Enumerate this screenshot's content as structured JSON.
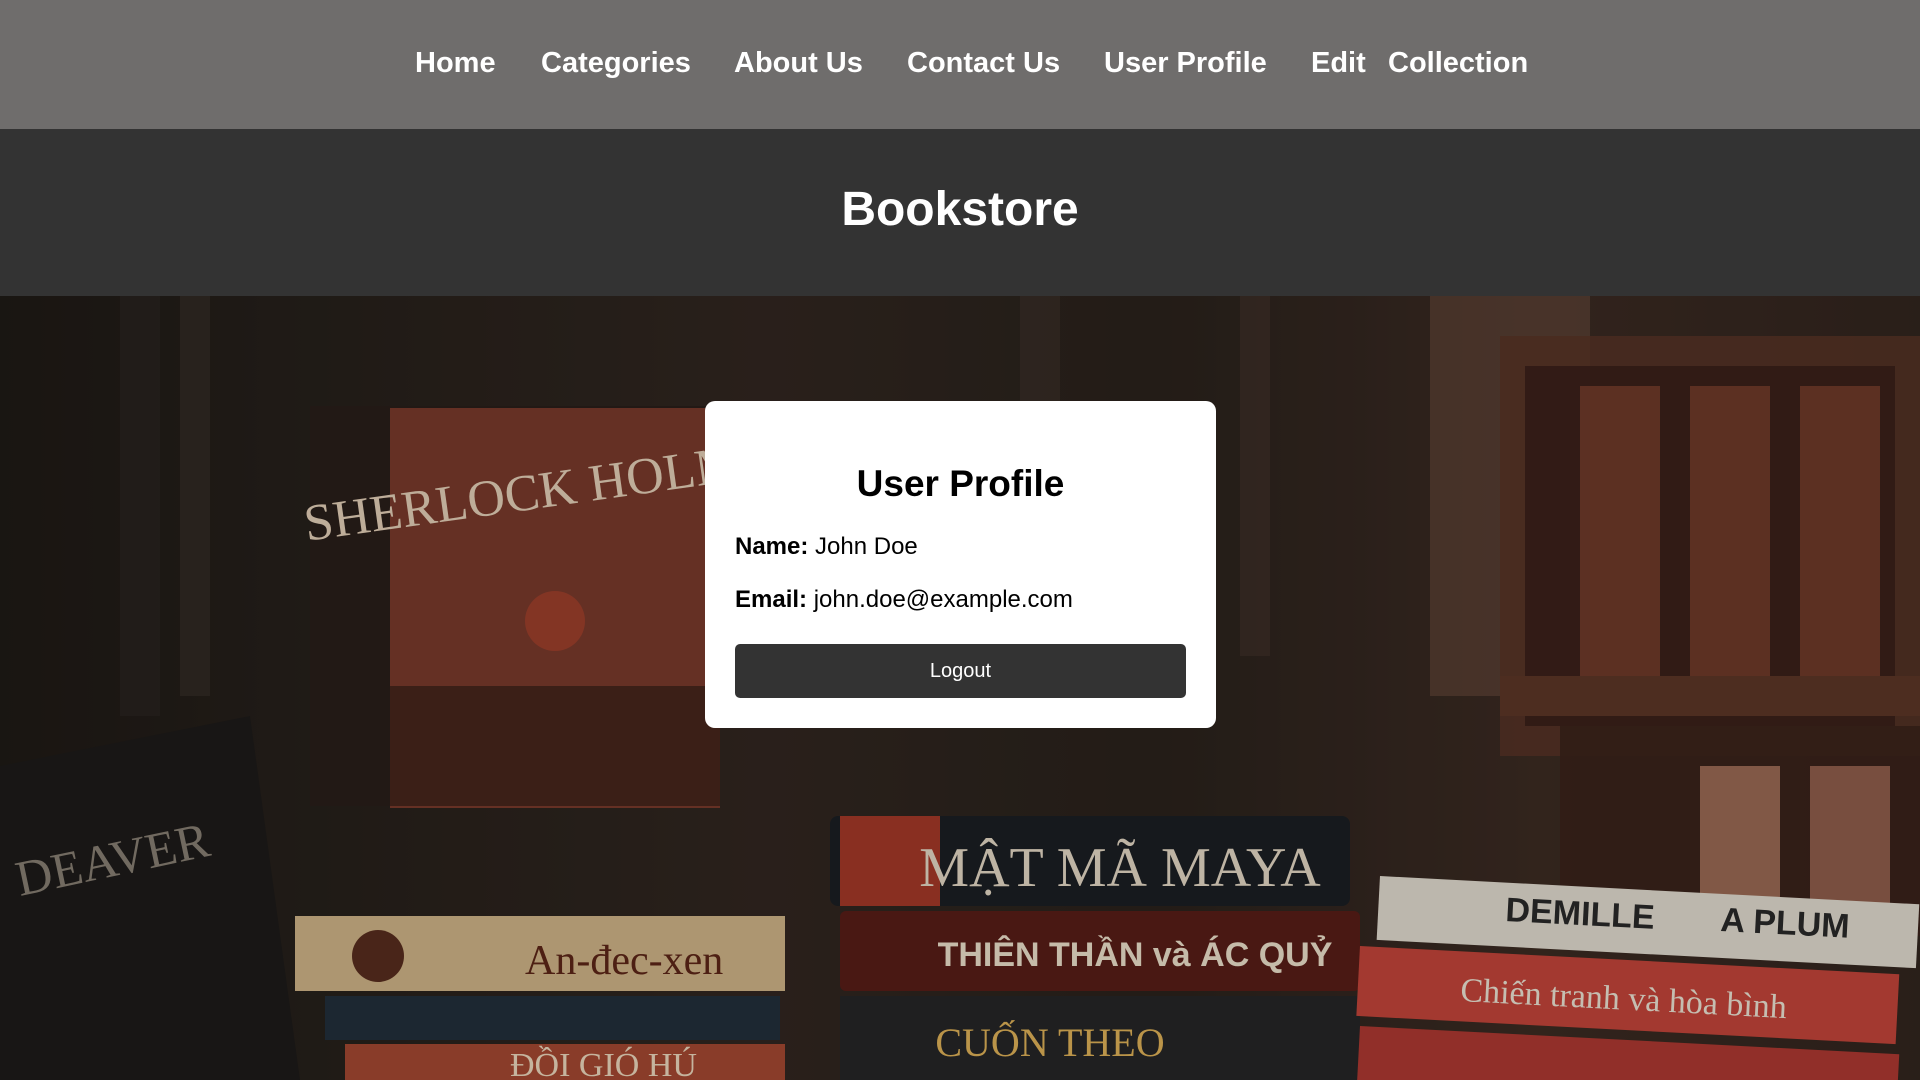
{
  "nav": {
    "items": [
      {
        "label": "Home"
      },
      {
        "label": "Categories"
      },
      {
        "label": "About Us"
      },
      {
        "label": "Contact Us"
      },
      {
        "label": "User Profile"
      },
      {
        "label": "Edit"
      },
      {
        "label": "Collection"
      }
    ]
  },
  "header": {
    "title": "Bookstore"
  },
  "profile": {
    "title": "User Profile",
    "name_label": "Name:",
    "name_value": "John Doe",
    "email_label": "Email:",
    "email_value": "john.doe@example.com",
    "logout_label": "Logout"
  },
  "background": {
    "book_titles": [
      "SHERLOCK HOLMES",
      "MẬT MÃ MAYA",
      "THIÊN THẦN và ÁC QUỶ",
      "An-đec-xen",
      "ĐỒI GIÓ HÚ",
      "CUỐN THEO CHIỀU GIÓ",
      "DEMILLE",
      "A PLUM",
      "Chiến tranh và hòa bình",
      "DEAVER"
    ]
  },
  "colors": {
    "nav_bg": "#6f6d6c",
    "header_bg": "#333333",
    "card_bg": "#ffffff",
    "button_bg": "#333333"
  }
}
